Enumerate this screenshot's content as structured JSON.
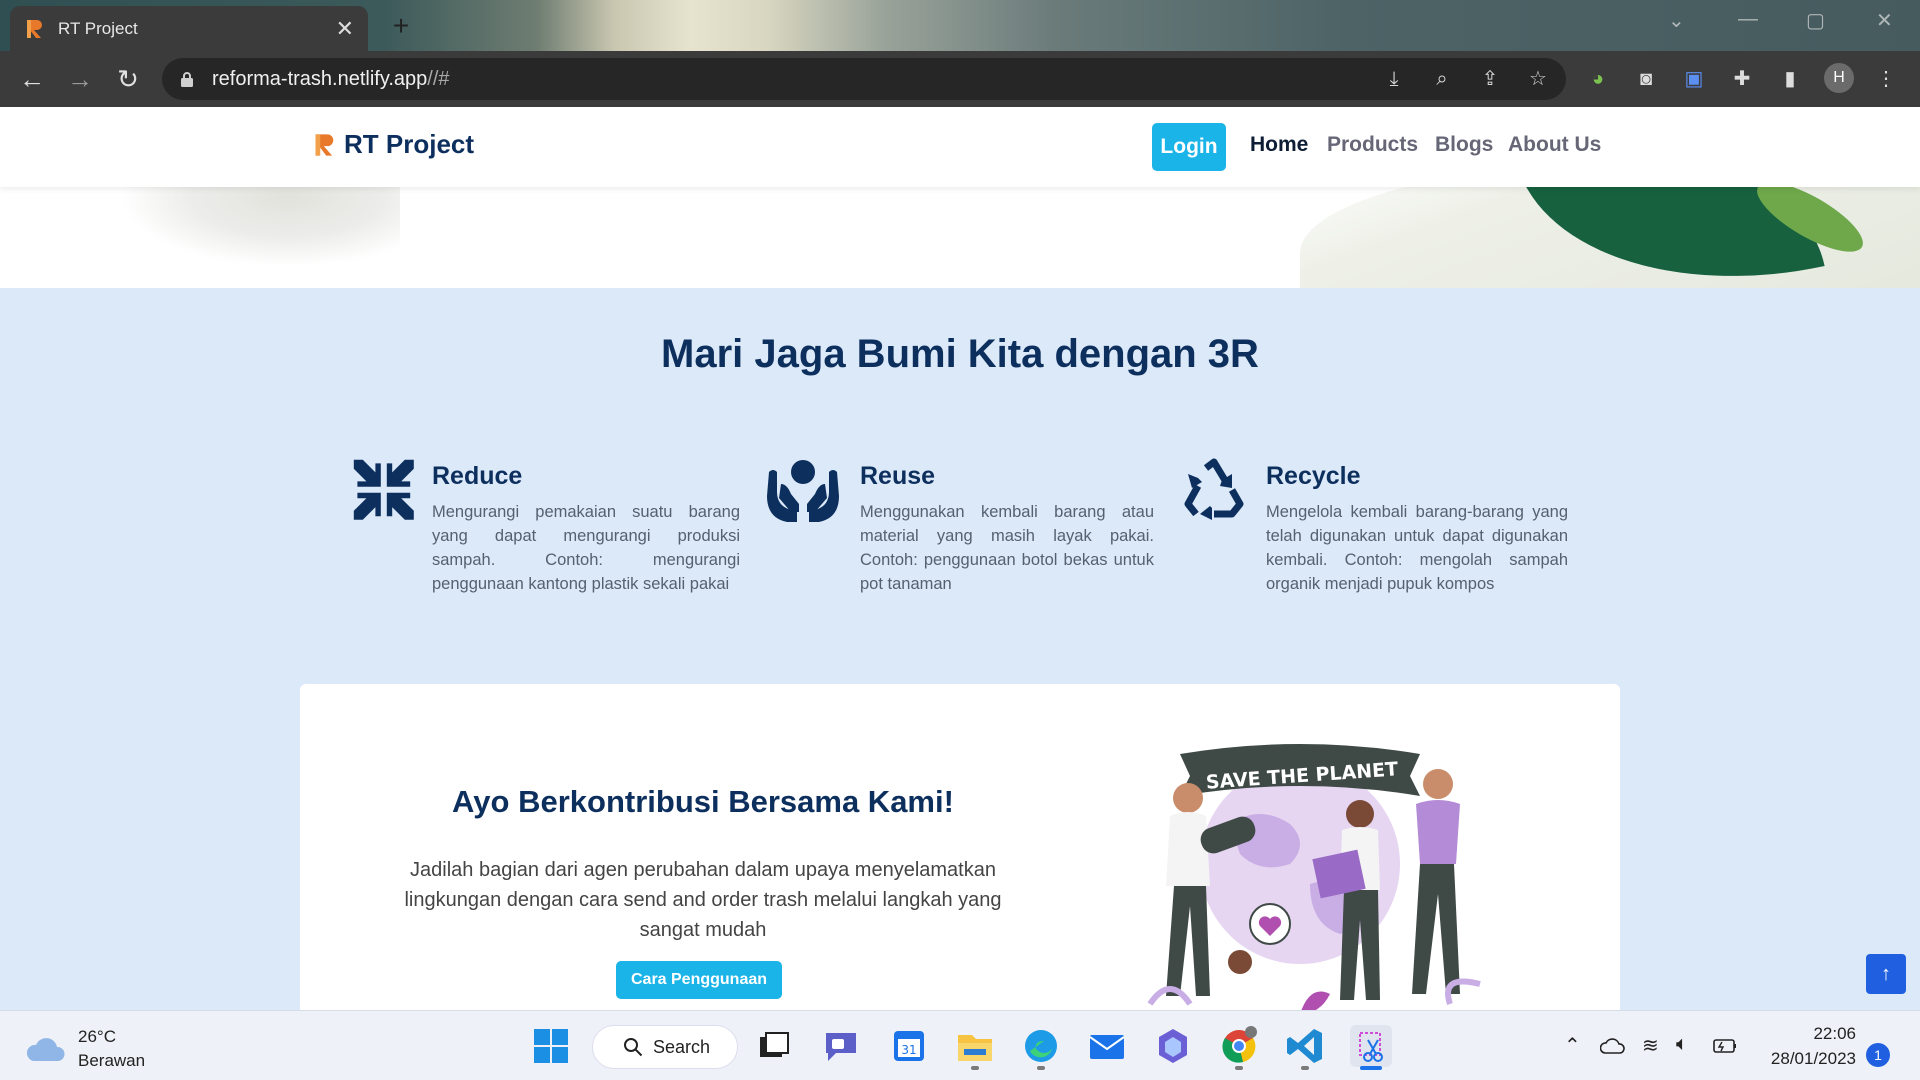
{
  "browser": {
    "tab_title": "RT Project",
    "url_main": "reforma-trash.netlify.app",
    "url_rest": "//#",
    "profile_initial": "H"
  },
  "site": {
    "brand": "RT Project",
    "nav": {
      "login": "Login",
      "home": "Home",
      "products": "Products",
      "blogs": "Blogs",
      "about": "About Us"
    }
  },
  "section_3r": {
    "title": "Mari Jaga Bumi Kita dengan 3R",
    "items": [
      {
        "title": "Reduce",
        "desc": "Mengurangi pemakaian suatu barang yang dapat mengurangi produksi sampah. Contoh: mengurangi penggunaan kantong plastik sekali pakai",
        "icon": "compress-arrows-icon"
      },
      {
        "title": "Reuse",
        "desc": "Menggunakan kembali barang atau material yang masih layak pakai. Contoh: penggunaan botol bekas untuk pot tanaman",
        "icon": "hands-holding-icon"
      },
      {
        "title": "Recycle",
        "desc": "Mengelola kembali barang-barang yang telah digunakan untuk dapat digunakan kembali. Contoh: mengolah sampah organik menjadi pupuk kompos",
        "icon": "recycle-icon"
      }
    ]
  },
  "contribute": {
    "title": "Ayo Berkontribusi Bersama Kami!",
    "body": "Jadilah bagian dari agen perubahan dalam upaya menyelamatkan lingkungan dengan cara send and order trash melalui langkah yang sangat mudah",
    "cta": "Cara Penggunaan",
    "banner": "SAVE THE PLANET"
  },
  "taskbar": {
    "weather_temp": "26°C",
    "weather_desc": "Berawan",
    "search_label": "Search",
    "time": "22:06",
    "date": "28/01/2023",
    "notifications": "1"
  },
  "colors": {
    "primary_navy": "#0d2f5e",
    "accent_cyan": "#1ab4e8",
    "section_bg": "#dce9f8"
  }
}
